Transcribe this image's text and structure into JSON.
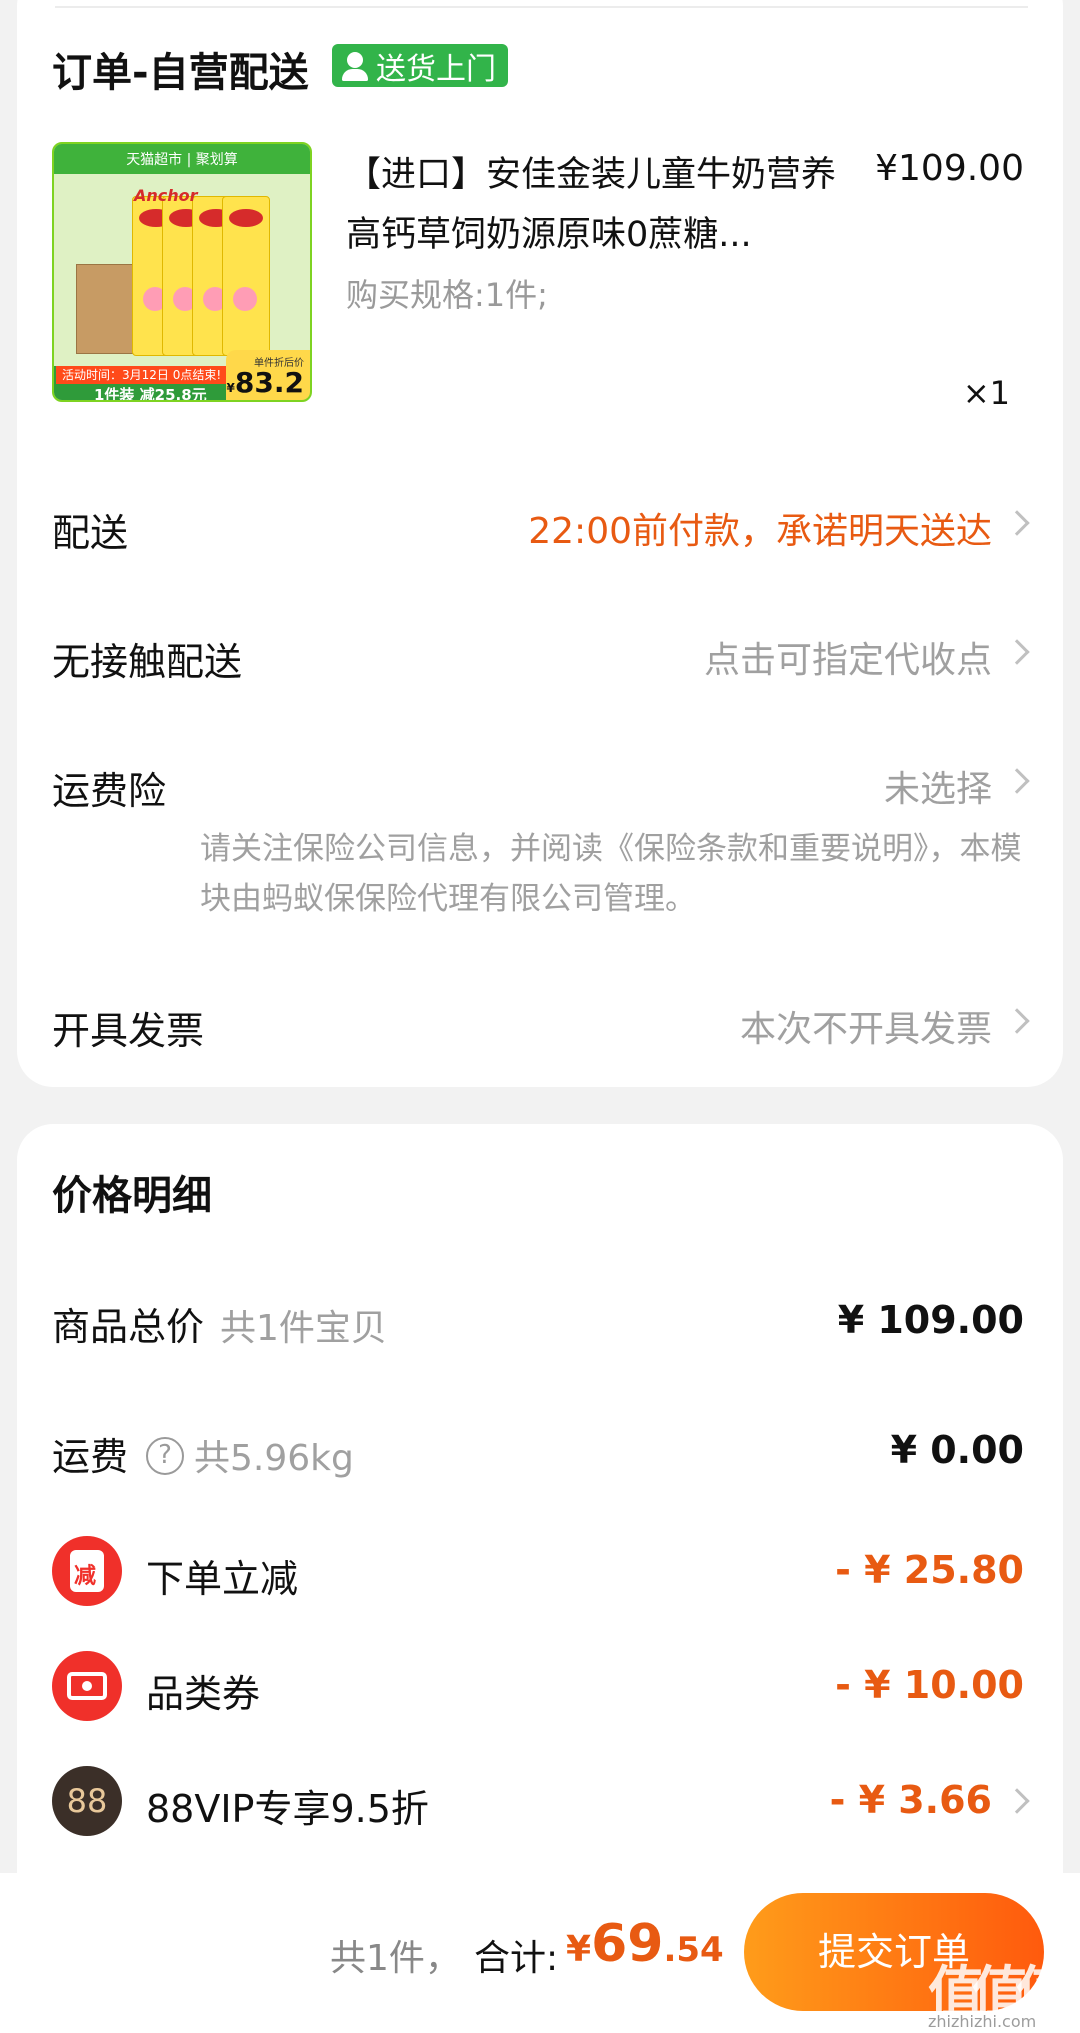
{
  "order": {
    "title": "订单-自营配送",
    "delivery_badge": "送货上门",
    "badge_icon": "person-icon",
    "accent_green": "#32b44a"
  },
  "product": {
    "image_banner": "天猫超市 | 聚划算",
    "image_brand": "Anchor",
    "image_date": "活动时间：3月12日 0点结束!",
    "image_deal": "1件装 减25.8元",
    "image_price_label": "单件折后价",
    "image_price_symbol": "¥",
    "image_price": "83.2",
    "title": "【进口】安佳金装儿童牛奶营养高钙草饲奶源原味0蔗糖...",
    "price": "¥109.00",
    "spec": "购买规格:1件;",
    "qty": "×1"
  },
  "rows": {
    "delivery_label": "配送",
    "delivery_value": "22:00前付款，承诺明天送达",
    "contactless_label": "无接触配送",
    "contactless_value": "点击可指定代收点",
    "insurance_label": "运费险",
    "insurance_value": "未选择",
    "insurance_note": "请关注保险公司信息，并阅读《保险条款和重要说明》，本模块由蚂蚁保保险代理有限公司管理。",
    "invoice_label": "开具发票",
    "invoice_value": "本次不开具发票",
    "accent_orange": "#e85a12"
  },
  "price_detail": {
    "title": "价格明细",
    "goods_label": "商品总价",
    "goods_sub": "共1件宝贝",
    "goods_value": "¥ 109.00",
    "shipping_label": "运费",
    "shipping_help": "?",
    "shipping_weight": "共5.96kg",
    "shipping_value": "¥ 0.00",
    "discounts": [
      {
        "icon": "discount-jar-icon",
        "icon_text": "减",
        "label": "下单立减",
        "value": "- ¥ 25.80"
      },
      {
        "icon": "coupon-ticket-icon",
        "label": "品类券",
        "value": "- ¥ 10.00"
      },
      {
        "icon": "vip-88-icon",
        "icon_text": "88",
        "label": "88VIP专享9.5折",
        "value": "- ¥ 3.66"
      }
    ]
  },
  "footer": {
    "count": "共1件，",
    "total_label": "合计:",
    "total_symbol": "¥",
    "total_int": "69",
    "total_dec": ".54",
    "submit": "提交订单"
  },
  "watermark": {
    "chars": [
      "值",
      "值",
      "值"
    ],
    "url": "zhizhizhi.com"
  }
}
